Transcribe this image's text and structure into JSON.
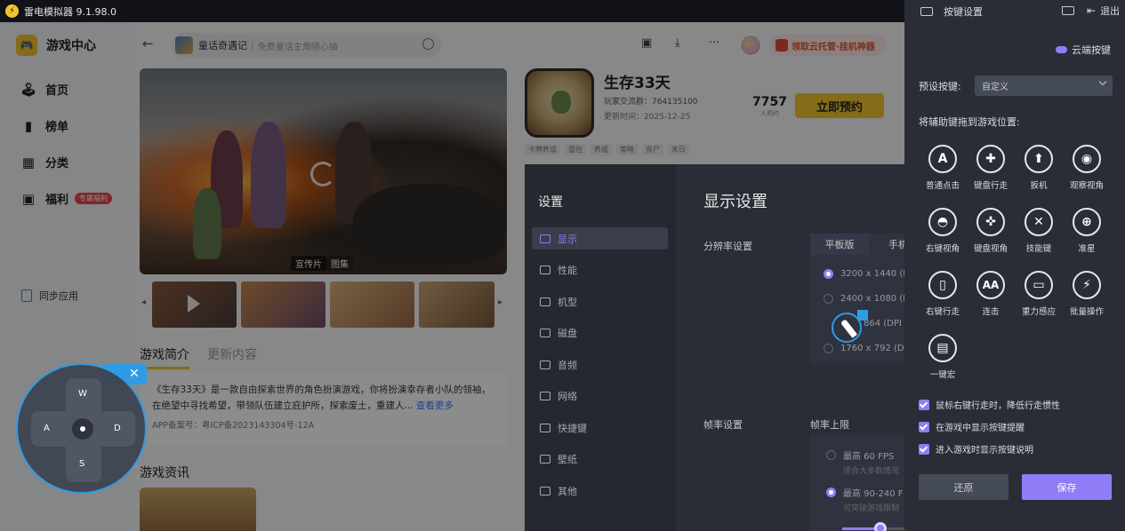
{
  "titlebar": {
    "title": "雷电模拟器 9.1.98.0"
  },
  "sidebar": {
    "title": "游戏中心",
    "items": [
      {
        "label": "首页",
        "icon": "gamepad-icon"
      },
      {
        "label": "榜单",
        "icon": "chart-bars-icon"
      },
      {
        "label": "分类",
        "icon": "grid-icon"
      },
      {
        "label": "福利",
        "icon": "gift-icon",
        "badge": "专属福利"
      }
    ],
    "sync": "同步应用"
  },
  "topbar": {
    "search_title": "童话奇遇记",
    "search_placeholder": "免费童话主角随心抽",
    "promo": "领取云托管·挂机神器"
  },
  "hero": {
    "tabs": [
      "宣传片",
      "图集"
    ]
  },
  "game": {
    "name": "生存33天",
    "group": "玩家交流群：764135100",
    "update": "更新时间：2025-12-25",
    "reserve_count": "7757",
    "reserve_label": "人预约",
    "reserve_button": "立即预约",
    "tags": [
      "卡牌养成",
      "冒险",
      "养成",
      "策略",
      "丧尸",
      "末日"
    ]
  },
  "game_tabs": [
    "游戏简介",
    "更新内容"
  ],
  "intro": {
    "text": "《生存33天》是一款自由探索世界的角色扮演游戏，你将扮演幸存者小队的领袖，在绝望中寻找希望，带领队伍建立庇护所，探索废土，重建人...",
    "more": "查看更多",
    "license": "APP备案号：粤ICP备2023143304号-12A"
  },
  "news_title": "游戏资讯",
  "settings": {
    "title": "设置",
    "nav": [
      "显示",
      "性能",
      "机型",
      "磁盘",
      "音频",
      "网络",
      "快捷键",
      "壁纸",
      "其他"
    ],
    "content_title": "显示设置",
    "resolution_label": "分辨率设置",
    "res_tabs": [
      "平板版",
      "手机"
    ],
    "res_options": [
      "3200 x 1440 (DP",
      "2400 x 1080 (DP",
      "864 (DPI",
      "1760 x 792 (DPI"
    ],
    "fps_label": "帧率设置",
    "fps_limit_label": "帧率上限",
    "fps_options": [
      {
        "label": "最高 60 FPS",
        "sub": "适合大多数情况"
      },
      {
        "label": "最高 90-240 F",
        "sub": "可突破游戏限制"
      }
    ]
  },
  "joystick": {
    "keys": {
      "up": "W",
      "left": "A",
      "right": "D",
      "down": "S"
    }
  },
  "panel": {
    "title": "按键设置",
    "exit": "退出",
    "cloud_keys": "云端按键",
    "preset_label": "预设按键:",
    "preset_value": "自定义",
    "drag_hint": "将辅助键拖到游戏位置:",
    "tools": [
      {
        "label": "普通点击",
        "glyph": "A",
        "icon": "letter-a-icon"
      },
      {
        "label": "键盘行走",
        "glyph": "✚",
        "icon": "dpad-icon"
      },
      {
        "label": "扳机",
        "glyph": "⬆",
        "icon": "bullet-icon"
      },
      {
        "label": "观察视角",
        "glyph": "◉",
        "icon": "eye-icon"
      },
      {
        "label": "右键视角",
        "glyph": "◓",
        "icon": "right-view-icon"
      },
      {
        "label": "键盘视角",
        "glyph": "✜",
        "icon": "keyboard-view-icon"
      },
      {
        "label": "技能键",
        "glyph": "✕",
        "icon": "crossed-swords-icon"
      },
      {
        "label": "准星",
        "glyph": "⊕",
        "icon": "crosshair-icon"
      },
      {
        "label": "右键行走",
        "glyph": "▯",
        "icon": "mouse-icon"
      },
      {
        "label": "连击",
        "glyph": "AA",
        "icon": "combo-icon"
      },
      {
        "label": "重力感应",
        "glyph": "▭",
        "icon": "phone-gravity-icon"
      },
      {
        "label": "批量操作",
        "glyph": "⚡",
        "icon": "lightning-icon"
      },
      {
        "label": "一键宏",
        "glyph": "▤",
        "icon": "macro-icon"
      }
    ],
    "options": [
      "鼠标右键行走时，降低行走惯性",
      "在游戏中显示按键提醒",
      "进入游戏时显示按键说明"
    ],
    "restore": "还原",
    "save": "保存"
  }
}
